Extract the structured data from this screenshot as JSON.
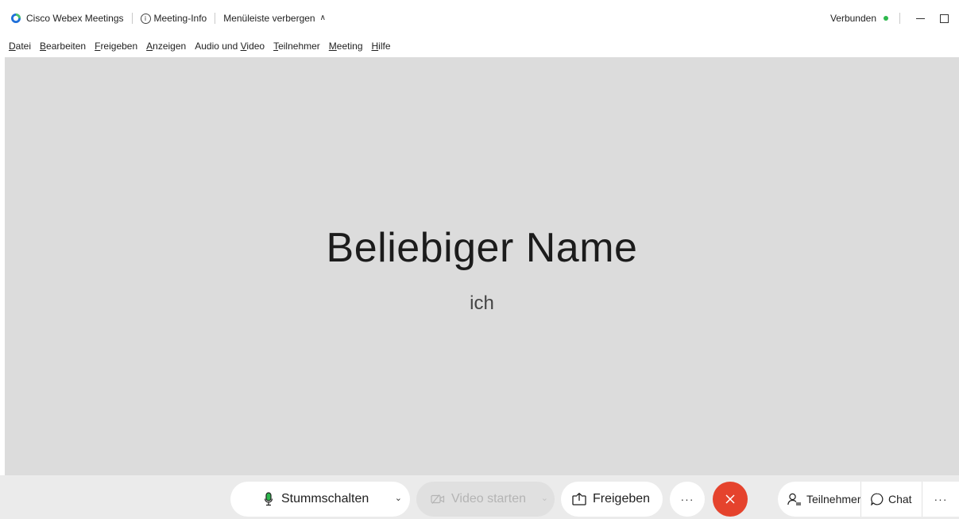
{
  "titlebar": {
    "app_name": "Cisco Webex Meetings",
    "meeting_info": "Meeting-Info",
    "hide_menu": "Menüleiste verbergen",
    "status": "Verbunden",
    "status_color": "#2db84d",
    "logo_color": "#1e6fd9"
  },
  "menubar": {
    "items": [
      {
        "accel": "D",
        "rest": "atei"
      },
      {
        "accel": "B",
        "rest": "earbeiten"
      },
      {
        "accel": "F",
        "rest": "reigeben"
      },
      {
        "accel": "A",
        "rest": "nzeigen"
      },
      {
        "pre": "Audio und ",
        "accel": "V",
        "rest": "ideo"
      },
      {
        "accel": "T",
        "rest": "eilnehmer"
      },
      {
        "accel": "M",
        "rest": "eeting"
      },
      {
        "accel": "H",
        "rest": "ilfe"
      }
    ]
  },
  "stage": {
    "participant_name": "Beliebiger Name",
    "participant_subtitle": "ich",
    "background": "#dcdcdc"
  },
  "controls": {
    "mute_label": "Stummschalten",
    "video_label": "Video starten",
    "share_label": "Freigeben",
    "more_label": "···",
    "leave_color": "#e5432d",
    "mic_color": "#2db84d",
    "participants_label": "Teilnehmer",
    "chat_label": "Chat",
    "panel_more_label": "···"
  }
}
